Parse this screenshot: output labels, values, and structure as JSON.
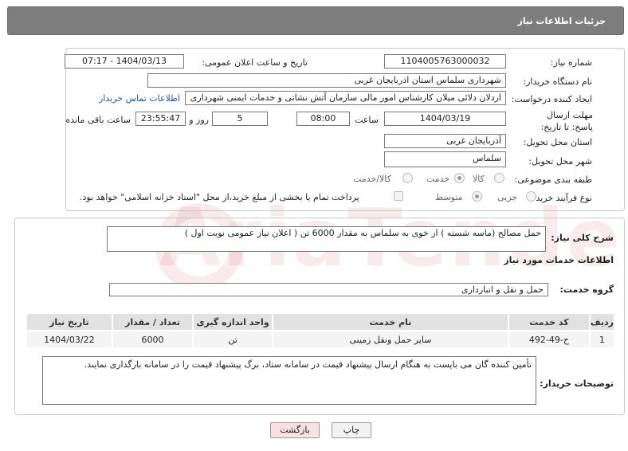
{
  "header": {
    "title": "جزئیات اطلاعات نیاز"
  },
  "form": {
    "need_number_label": "شماره نیاز:",
    "need_number": "1104005763000032",
    "announce_label": "تاریخ و ساعت اعلان عمومی:",
    "announce_value": "1404/03/13 - 07:17",
    "buyer_label": "نام دستگاه خریدار:",
    "buyer_value": "شهرداری سلماس استان اذربایجان غربی",
    "creator_label": "ایجاد کننده درخواست:",
    "creator_value": "اردلان دلائی میلان کارشناس امور مالی سازمان آتش نشانی و خدمات ایمنی شهرداری",
    "contact_link": "اطلاعات تماس خریدار",
    "deadline_label": "مهلت ارسال پاسخ: تا تاریخ:",
    "deadline_date": "1404/03/19",
    "time_label": "ساعت",
    "deadline_time": "08:00",
    "days_value": "5",
    "days_label": "روز و",
    "remaining_value": "23:55:47",
    "remaining_label": "ساعت باقی مانده",
    "province_label": "استان محل تحویل:",
    "province_value": "آذربایجان غربی",
    "city_label": "شهر محل تحویل:",
    "city_value": "سلماس",
    "category_label": "طبقه بندی موضوعی:",
    "category_options": [
      "کالا",
      "خدمت",
      "کالا/خدمت"
    ],
    "process_label": "نوع فرآیند خرید :",
    "process_options": [
      "جزیی",
      "متوسط"
    ],
    "treasury_text": "پرداخت تمام یا بخشی از مبلغ خرید،از محل \"اسناد خزانه اسلامی\" خواهد بود."
  },
  "summary": {
    "label": "شرح کلی نیاز:",
    "text": "حمل مصالح (ماسه شسته ) از خوی به سلماس به مقدار 6000 تن ( اعلان نیاز عمومی نوبت اول )"
  },
  "services": {
    "title": "اطلاعات خدمات مورد نیاز",
    "group_label": "گروه خدمت:",
    "group_value": "حمل و نقل و انبارداری",
    "columns": [
      "ردیف",
      "کد خدمت",
      "نام خدمت",
      "واحد اندازه گیری",
      "تعداد / مقدار",
      "تاریخ نیاز"
    ],
    "rows": [
      [
        "1",
        "ح-49-492",
        "سایر حمل ونقل زمینی",
        "تن",
        "6000",
        "1404/03/22"
      ]
    ]
  },
  "notes": {
    "label": "توضیحات خریدار:",
    "text": "تأمین کننده گان می بایست به هنگام ارسال پیشنهاد قیمت در سامانه ستاد، برگ پیشنهاد قیمت را در سامانه بارگذاری نمایند."
  },
  "buttons": {
    "print": "چاپ",
    "back": "بازگشت"
  },
  "watermark": "AriaTender.neT",
  "colors": {
    "header_bg": "#7d7d7d",
    "link": "#1a56c2",
    "back_button_bg": "#fbe0e0"
  }
}
